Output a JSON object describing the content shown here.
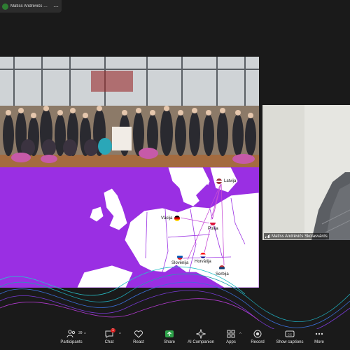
{
  "share_bar": {
    "label": "Matīss Andrēvičs Skolasvārds's sc",
    "accent": "#2e7d32"
  },
  "slide": {
    "map_bg": "#9a2fe3",
    "land_color": "#ffffff",
    "countries": [
      {
        "name": "Latvija",
        "flag": "latvia-flag"
      },
      {
        "name": "Vācija",
        "flag": "germany-flag"
      },
      {
        "name": "Polija",
        "flag": "poland-flag"
      },
      {
        "name": "Slovēnija",
        "flag": "slovenia-flag"
      },
      {
        "name": "Horvātija",
        "flag": "croatia-flag"
      },
      {
        "name": "Serbija",
        "flag": "serbia-flag"
      }
    ]
  },
  "participant": {
    "name": "Matīss Andrēvičs Skolasvārds"
  },
  "toolbar": {
    "items": [
      {
        "label": "Participants",
        "icon": "participants-icon",
        "count": "39"
      },
      {
        "label": "Chat",
        "icon": "chat-icon",
        "badge": "1"
      },
      {
        "label": "React",
        "icon": "heart-icon"
      },
      {
        "label": "Share",
        "icon": "share-screen-icon"
      },
      {
        "label": "AI Companion",
        "icon": "ai-companion-icon"
      },
      {
        "label": "Apps",
        "icon": "apps-icon"
      },
      {
        "label": "Record",
        "icon": "record-icon"
      },
      {
        "label": "Show captions",
        "icon": "captions-icon"
      },
      {
        "label": "More",
        "icon": "more-icon"
      }
    ]
  }
}
